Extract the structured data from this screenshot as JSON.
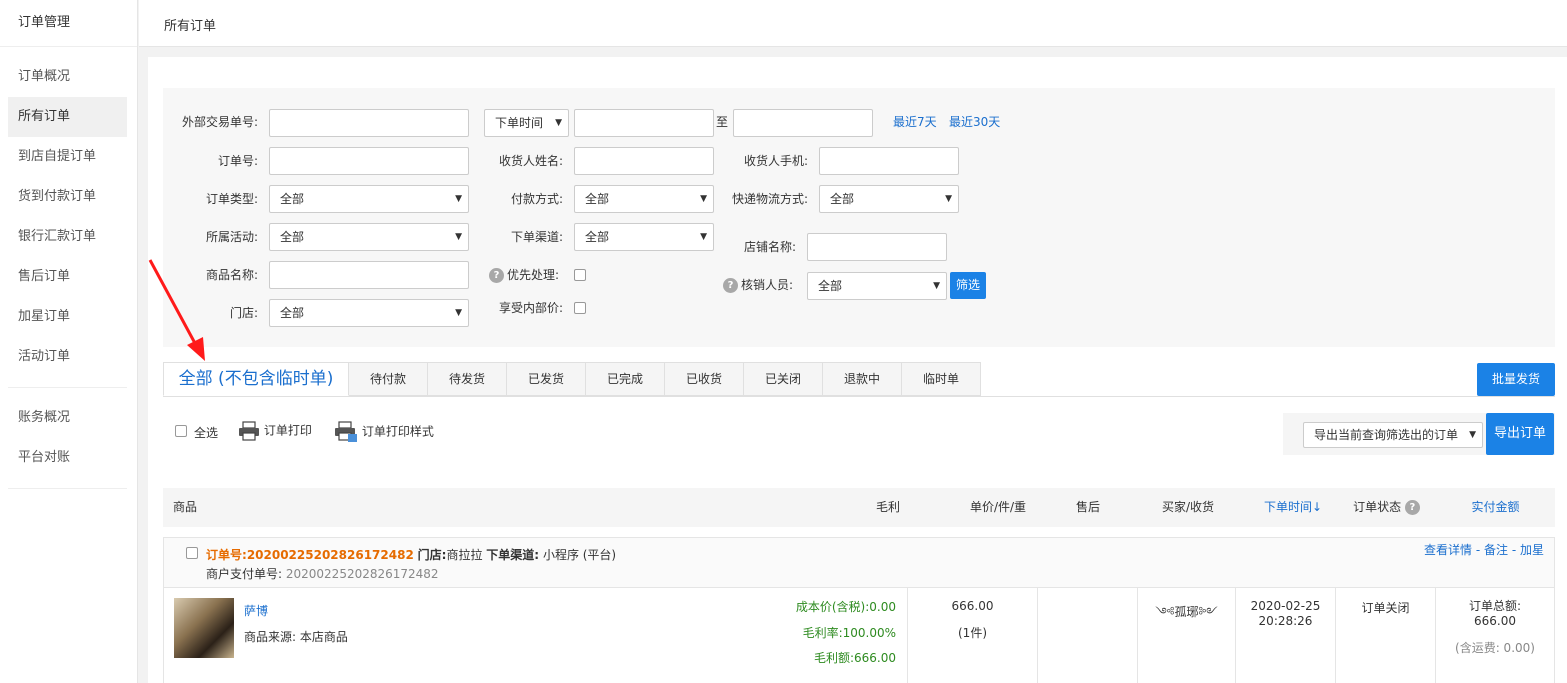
{
  "sidebar": {
    "title": "订单管理",
    "items": [
      {
        "label": "订单概况"
      },
      {
        "label": "所有订单"
      },
      {
        "label": "到店自提订单"
      },
      {
        "label": "货到付款订单"
      },
      {
        "label": "银行汇款订单"
      },
      {
        "label": "售后订单"
      },
      {
        "label": "加星订单"
      },
      {
        "label": "活动订单"
      }
    ],
    "items2": [
      {
        "label": "账务概况"
      },
      {
        "label": "平台对账"
      }
    ]
  },
  "header": {
    "title": "所有订单"
  },
  "filter": {
    "external_trade_no": "外部交易单号:",
    "time_type": "下单时间",
    "to": "至",
    "last7": "最近7天",
    "last30": "最近30天",
    "order_no": "订单号:",
    "receiver_name": "收货人姓名:",
    "receiver_phone": "收货人手机:",
    "order_type": "订单类型:",
    "order_type_value": "全部",
    "pay_method": "付款方式:",
    "pay_method_value": "全部",
    "express": "快递物流方式:",
    "express_value": "全部",
    "activity": "所属活动:",
    "activity_value": "全部",
    "channel": "下单渠道:",
    "channel_value": "全部",
    "shop_name": "店铺名称:",
    "product_name": "商品名称:",
    "priority": "优先处理:",
    "verifier": "核销人员:",
    "verifier_value": "全部",
    "filter_btn": "筛选",
    "store": "门店:",
    "store_value": "全部",
    "internal_price": "享受内部价:"
  },
  "tabs": [
    {
      "label": "全部 (不包含临时单)"
    },
    {
      "label": "待付款"
    },
    {
      "label": "待发货"
    },
    {
      "label": "已发货"
    },
    {
      "label": "已完成"
    },
    {
      "label": "已收货"
    },
    {
      "label": "已关闭"
    },
    {
      "label": "退款中"
    },
    {
      "label": "临时单"
    }
  ],
  "batch_ship": "批量发货",
  "toolbar": {
    "select_all": "全选",
    "print": "订单打印",
    "print_style": "订单打印样式",
    "export_option": "导出当前查询筛选出的订单",
    "export_btn": "导出订单"
  },
  "table": {
    "headers": {
      "product": "商品",
      "profit": "毛利",
      "price": "单价/件/重",
      "after_sale": "售后",
      "buyer": "买家/收货",
      "order_time": "下单时间↓",
      "status": "订单状态",
      "paid": "实付金额"
    }
  },
  "order": {
    "no_label": "订单号:",
    "no": "20200225202826172482",
    "store_label": "门店:",
    "store": "商拉拉",
    "channel_label": "下单渠道:",
    "channel": "小程序 (平台)",
    "merchant_pay_label": "商户支付单号:",
    "merchant_pay_no": "20200225202826172482",
    "action_detail": "查看详情",
    "action_sep1": " - ",
    "action_note": "备注",
    "action_sep2": " - ",
    "action_star": "加星",
    "product_name": "萨博",
    "product_source": "商品来源: 本店商品",
    "cost": "成本价(含税):0.00",
    "profit_rate": "毛利率:100.00%",
    "profit_amount": "毛利额:666.00",
    "unit_price": "666.00",
    "qty": "(1件)",
    "buyer": "༺孤琊༻",
    "date": "2020-02-25",
    "time": "20:28:26",
    "status": "订单关闭",
    "total_label": "订单总额:",
    "total": "666.00",
    "shipping": "(含运费: 0.00)"
  }
}
